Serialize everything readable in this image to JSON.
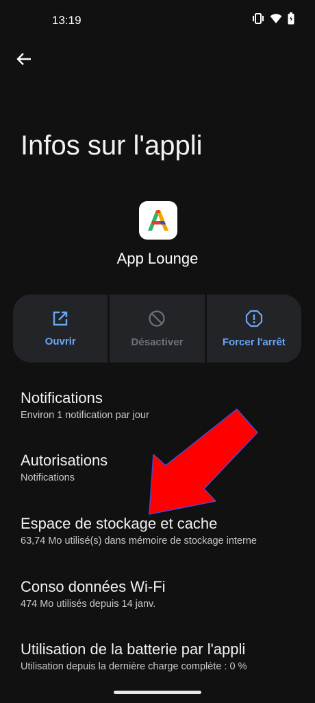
{
  "status_bar": {
    "time": "13:19",
    "icons": [
      "vibrate-icon",
      "wifi-icon",
      "battery-icon"
    ]
  },
  "header": {
    "back_icon": "arrow-left-icon",
    "title": "Infos sur l'appli"
  },
  "app": {
    "name": "App Lounge",
    "icon": "app-lounge-logo"
  },
  "actions": [
    {
      "label": "Ouvrir",
      "icon": "open-external-icon",
      "enabled": true
    },
    {
      "label": "Désactiver",
      "icon": "disable-icon",
      "enabled": false
    },
    {
      "label": "Forcer l'arrêt",
      "icon": "force-stop-icon",
      "enabled": true
    }
  ],
  "settings": [
    {
      "title": "Notifications",
      "subtitle": "Environ 1 notification par jour"
    },
    {
      "title": "Autorisations",
      "subtitle": "Notifications"
    },
    {
      "title": "Espace de stockage et cache",
      "subtitle": "63,74 Mo utilisé(s) dans mémoire de stockage interne"
    },
    {
      "title": "Conso données Wi-Fi",
      "subtitle": "474 Mo utilisés depuis 14 janv."
    },
    {
      "title": "Utilisation de la batterie par l'appli",
      "subtitle": "Utilisation depuis la dernière charge complète : 0 %"
    }
  ],
  "colors": {
    "background": "#111111",
    "accent": "#6aa7f5",
    "action_bg": "#222428",
    "disabled": "#6f7276",
    "arrow": "#ff0000"
  }
}
